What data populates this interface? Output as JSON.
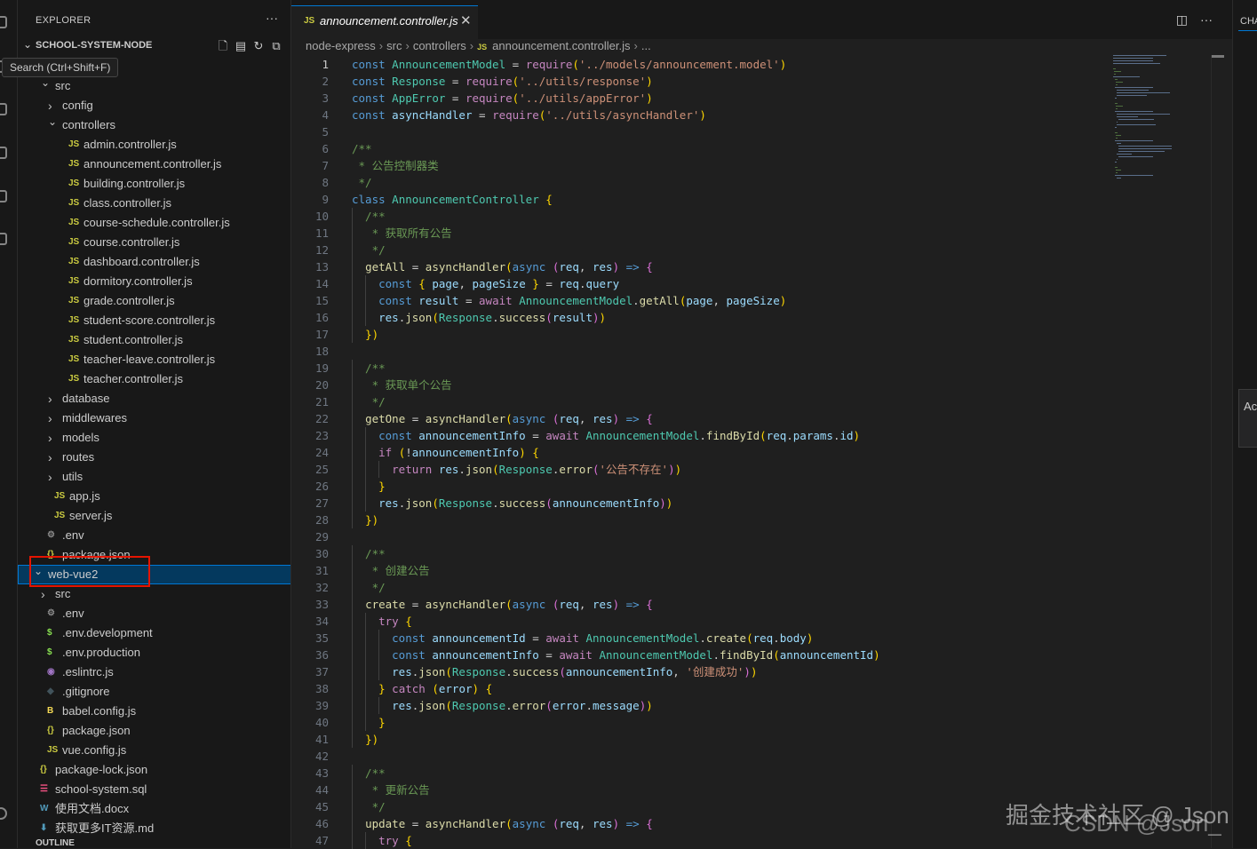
{
  "explorer": {
    "title": "EXPLORER",
    "more": "···",
    "workspace": "SCHOOL-SYSTEM-NODE",
    "tooltip": "Search (Ctrl+Shift+F)",
    "tree": [
      {
        "label": "src",
        "type": "folder-open"
      },
      {
        "label": "config",
        "type": "folder"
      },
      {
        "label": "controllers",
        "type": "folder-open"
      },
      {
        "label": "admin.controller.js",
        "type": "js"
      },
      {
        "label": "announcement.controller.js",
        "type": "js"
      },
      {
        "label": "building.controller.js",
        "type": "js"
      },
      {
        "label": "class.controller.js",
        "type": "js"
      },
      {
        "label": "course-schedule.controller.js",
        "type": "js"
      },
      {
        "label": "course.controller.js",
        "type": "js"
      },
      {
        "label": "dashboard.controller.js",
        "type": "js"
      },
      {
        "label": "dormitory.controller.js",
        "type": "js"
      },
      {
        "label": "grade.controller.js",
        "type": "js"
      },
      {
        "label": "student-score.controller.js",
        "type": "js"
      },
      {
        "label": "student.controller.js",
        "type": "js"
      },
      {
        "label": "teacher-leave.controller.js",
        "type": "js"
      },
      {
        "label": "teacher.controller.js",
        "type": "js"
      },
      {
        "label": "database",
        "type": "folder"
      },
      {
        "label": "middlewares",
        "type": "folder"
      },
      {
        "label": "models",
        "type": "folder"
      },
      {
        "label": "routes",
        "type": "folder"
      },
      {
        "label": "utils",
        "type": "folder"
      },
      {
        "label": "app.js",
        "type": "js"
      },
      {
        "label": "server.js",
        "type": "js"
      },
      {
        "label": ".env",
        "type": "gear"
      },
      {
        "label": "package.json",
        "type": "json"
      },
      {
        "label": "web-vue2",
        "type": "folder-open"
      },
      {
        "label": "src",
        "type": "folder"
      },
      {
        "label": ".env",
        "type": "gear"
      },
      {
        "label": ".env.development",
        "type": "dollar"
      },
      {
        "label": ".env.production",
        "type": "dollar"
      },
      {
        "label": ".eslintrc.js",
        "type": "eslint"
      },
      {
        "label": ".gitignore",
        "type": "git"
      },
      {
        "label": "babel.config.js",
        "type": "babel"
      },
      {
        "label": "package.json",
        "type": "json"
      },
      {
        "label": "vue.config.js",
        "type": "js"
      },
      {
        "label": "package-lock.json",
        "type": "json"
      },
      {
        "label": "school-system.sql",
        "type": "db"
      },
      {
        "label": "使用文档.docx",
        "type": "word"
      },
      {
        "label": "获取更多IT资源.md",
        "type": "md"
      }
    ],
    "outline": "OUTLINE"
  },
  "editor": {
    "tab": {
      "icon": "JS",
      "title": "announcement.controller.js",
      "close": "✕"
    },
    "breadcrumbs": [
      "node-express",
      "src",
      "controllers",
      "announcement.controller.js",
      "..."
    ],
    "current_line": 1,
    "code": [
      "const AnnouncementModel = require('../models/announcement.model')",
      "const Response = require('../utils/response')",
      "const AppError = require('../utils/appError')",
      "const asyncHandler = require('../utils/asyncHandler')",
      "",
      "/**",
      " * 公告控制器类",
      " */",
      "class AnnouncementController {",
      "  /**",
      "   * 获取所有公告",
      "   */",
      "  getAll = asyncHandler(async (req, res) => {",
      "    const { page, pageSize } = req.query",
      "    const result = await AnnouncementModel.getAll(page, pageSize)",
      "    res.json(Response.success(result))",
      "  })",
      "",
      "  /**",
      "   * 获取单个公告",
      "   */",
      "  getOne = asyncHandler(async (req, res) => {",
      "    const announcementInfo = await AnnouncementModel.findById(req.params.id)",
      "    if (!announcementInfo) {",
      "      return res.json(Response.error('公告不存在'))",
      "    }",
      "    res.json(Response.success(announcementInfo))",
      "  })",
      "",
      "  /**",
      "   * 创建公告",
      "   */",
      "  create = asyncHandler(async (req, res) => {",
      "    try {",
      "      const announcementId = await AnnouncementModel.create(req.body)",
      "      const announcementInfo = await AnnouncementModel.findById(announcementId)",
      "      res.json(Response.success(announcementInfo, '创建成功'))",
      "    } catch (error) {",
      "      res.json(Response.error(error.message))",
      "    }",
      "  })",
      "",
      "  /**",
      "   * 更新公告",
      "   */",
      "  update = asyncHandler(async (req, res) => {",
      "    try {"
    ]
  },
  "right_panel": {
    "tab": "CHA",
    "button": "Ac"
  },
  "watermark": {
    "line1": "掘金技术社区 @ Json",
    "line2": "CSDN @Json_"
  },
  "colors": {
    "accent": "#0078d4",
    "selection": "#04395e",
    "highlight_box": "#e51400",
    "js_icon": "#cbcb41"
  }
}
